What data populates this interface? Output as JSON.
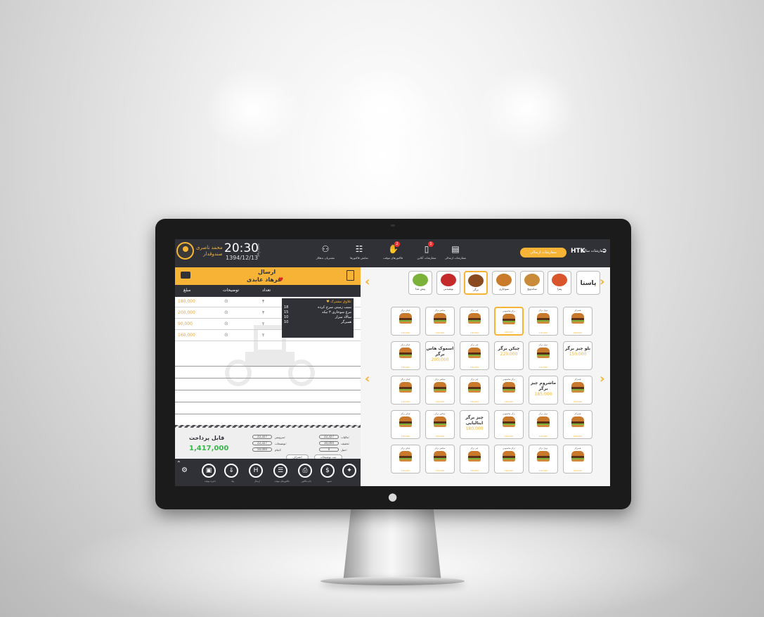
{
  "topbar": {
    "user_name": "محمد ناصری",
    "user_role": "صندوقدار",
    "clock": "20:30",
    "date": "1394/12/13",
    "day": "چهارشنبه",
    "nav": [
      {
        "icon": "order-sent-icon",
        "label": "سفارشات ارسالی"
      },
      {
        "icon": "customers-icon",
        "label": "مشتریان بدهکار"
      },
      {
        "icon": "invoice-search-icon",
        "label": "نمایش فاکتورها"
      },
      {
        "icon": "hand-icon",
        "label": "فاکتورهای موقت",
        "badge": "2"
      },
      {
        "icon": "mobile-order-icon",
        "label": "سفارشات آنلاین",
        "badge": "1"
      },
      {
        "icon": "report-icon",
        "label": "گزارش‌ها"
      }
    ],
    "send_pill": "سفارشات ارسالی",
    "brand": "HTK",
    "brand_text": "سفارشات سالن",
    "exit_icon": "exit-icon"
  },
  "order": {
    "type": "ارسال",
    "customer": "فرهاد عابدی",
    "columns": {
      "amount": "مبلغ",
      "desc": "توضیحات",
      "qty": "تعداد",
      "name": ""
    },
    "rows": [
      {
        "price": "180,000",
        "qty": "۴",
        "name": ""
      },
      {
        "price": "200,000",
        "qty": "۳",
        "name": ""
      },
      {
        "price": "90,000",
        "qty": "۲",
        "name": ""
      },
      {
        "price": "160,000",
        "qty": "۲",
        "name": "سالاد سزار"
      }
    ],
    "popup": {
      "title": "♥ علاوق مشترک",
      "lines": [
        {
          "n": "18",
          "t": "سیب زمینی سرخ کرده"
        },
        {
          "n": "15",
          "t": "مرغ سوخاری ۳ تیکه"
        },
        {
          "n": "10",
          "t": "سالاد سزار"
        },
        {
          "n": "10",
          "t": "همبرگر"
        }
      ]
    }
  },
  "summary": {
    "pay_label": "قابل پرداخت",
    "pay_value": "1,417,000",
    "fields": [
      {
        "label": "سرویس:",
        "value": "22,327"
      },
      {
        "label": "توضیحات:",
        "value": "22,327"
      },
      {
        "label": "انعام:",
        "value": "50,000"
      },
      {
        "label": "مالیات:",
        "value": "22,327"
      },
      {
        "label": "تخفیف:",
        "value": "30,000"
      },
      {
        "label": "حمل:",
        "value": "0"
      }
    ],
    "chips": {
      "save": "بسته بندی شود",
      "cancel": "انصراف",
      "note": "ثبت توضیحات"
    }
  },
  "bottombar": [
    {
      "icon": "magic-icon",
      "label": ""
    },
    {
      "icon": "dollar-icon",
      "label": "تسویه"
    },
    {
      "icon": "printer-icon",
      "label": "چاپ فاکتور"
    },
    {
      "icon": "invoice-icon",
      "label": "فاکتورهای موقت"
    },
    {
      "icon": "htk-icon",
      "label": "ارسال"
    },
    {
      "icon": "delivery-icon",
      "label": "پیک"
    },
    {
      "icon": "save-icon",
      "label": "ذخیره موقت"
    }
  ],
  "categories": [
    {
      "label": "پاستا",
      "style": "text"
    },
    {
      "label": "پیتزا",
      "color": "#d9552b"
    },
    {
      "label": "ساندویچ",
      "color": "#c98a3a"
    },
    {
      "label": "سوخاری",
      "color": "#c97a2a"
    },
    {
      "label": "برگر",
      "color": "#8a4a1f",
      "selected": true
    },
    {
      "label": "نوشیدنی",
      "color": "#c42a2a"
    },
    {
      "label": "پیش غذا",
      "color": "#7bb33a"
    }
  ],
  "menu_rows": [
    [
      {
        "title": "همبرگر",
        "price": "160,000"
      },
      {
        "title": "دوبل برگر",
        "price": "160,000"
      },
      {
        "title": "برگر مخصوص",
        "price": "220,000",
        "selected": true
      },
      {
        "title": "چیز برگر",
        "price": "180,000"
      },
      {
        "title": "میکس برگر",
        "price": "200,000"
      },
      {
        "title": "چیکن برگر",
        "price": "180,000"
      }
    ],
    [
      {
        "text": "بلو چیز برگر",
        "price": "150,000"
      },
      {
        "title": "دوبل برگر",
        "price": "160,000"
      },
      {
        "text": "چیکن برگر",
        "price": "220,000"
      },
      {
        "title": "چیز برگر",
        "price": "180,000"
      },
      {
        "text": "اسموک هاس برگر",
        "price": "200,000"
      },
      {
        "title": "چیکن برگر",
        "price": "180,000"
      }
    ],
    [
      {
        "title": "همبرگر",
        "price": "160,000"
      },
      {
        "text": "ماشروم چیز برگر",
        "price": "185,000"
      },
      {
        "title": "برگر مخصوص",
        "price": "220,000"
      },
      {
        "title": "چیز برگر",
        "price": "180,000"
      },
      {
        "title": "میکس برگر",
        "price": "200,000"
      },
      {
        "title": "چیکن برگر",
        "price": "180,000"
      }
    ],
    [
      {
        "title": "همبرگر",
        "price": "160,000"
      },
      {
        "title": "دوبل برگر",
        "price": "160,000"
      },
      {
        "title": "برگر مخصوص",
        "price": "220,000"
      },
      {
        "text": "چیز برگر ایتالیایی",
        "price": "180,000"
      },
      {
        "title": "میکس برگر",
        "price": "200,000"
      },
      {
        "title": "چیکن برگر",
        "price": "180,000"
      }
    ],
    [
      {
        "title": "همبرگر",
        "price": "160,000"
      },
      {
        "title": "دوبل برگر",
        "price": "160,000"
      },
      {
        "title": "برگر مخصوص",
        "price": "220,000"
      },
      {
        "title": "چیز برگر",
        "price": "180,000"
      },
      {
        "title": "میکس برگر",
        "price": "200,000"
      },
      {
        "title": "چیکن برگر",
        "price": "180,000"
      }
    ]
  ],
  "colors": {
    "accent": "#f6b335",
    "dark": "#2f3137",
    "green": "#39b54a"
  }
}
